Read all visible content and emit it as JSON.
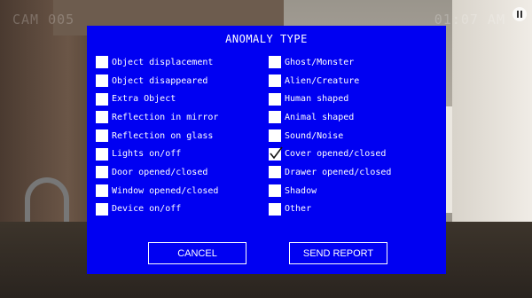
{
  "hud": {
    "camera": "CAM 005",
    "time": "01:07 AM"
  },
  "dialog": {
    "title": "ANOMALY TYPE",
    "left_options": [
      {
        "label": "Object displacement",
        "checked": false
      },
      {
        "label": "Object disappeared",
        "checked": false
      },
      {
        "label": "Extra Object",
        "checked": false
      },
      {
        "label": "Reflection in mirror",
        "checked": false
      },
      {
        "label": "Reflection on glass",
        "checked": false
      },
      {
        "label": "Lights on/off",
        "checked": false
      },
      {
        "label": "Door opened/closed",
        "checked": false
      },
      {
        "label": "Window opened/closed",
        "checked": false
      },
      {
        "label": "Device on/off",
        "checked": false
      }
    ],
    "right_options": [
      {
        "label": "Ghost/Monster",
        "checked": false
      },
      {
        "label": "Alien/Creature",
        "checked": false
      },
      {
        "label": "Human shaped",
        "checked": false
      },
      {
        "label": "Animal shaped",
        "checked": false
      },
      {
        "label": "Sound/Noise",
        "checked": false
      },
      {
        "label": "Cover opened/closed",
        "checked": true
      },
      {
        "label": "Drawer opened/closed",
        "checked": false
      },
      {
        "label": "Shadow",
        "checked": false
      },
      {
        "label": "Other",
        "checked": false
      }
    ],
    "cancel_label": "CANCEL",
    "send_label": "SEND REPORT"
  },
  "colors": {
    "dialog_bg": "#0000f2",
    "text": "#ffffff"
  },
  "icons": {
    "check": "checkmark-icon",
    "pause": "pause-icon"
  }
}
